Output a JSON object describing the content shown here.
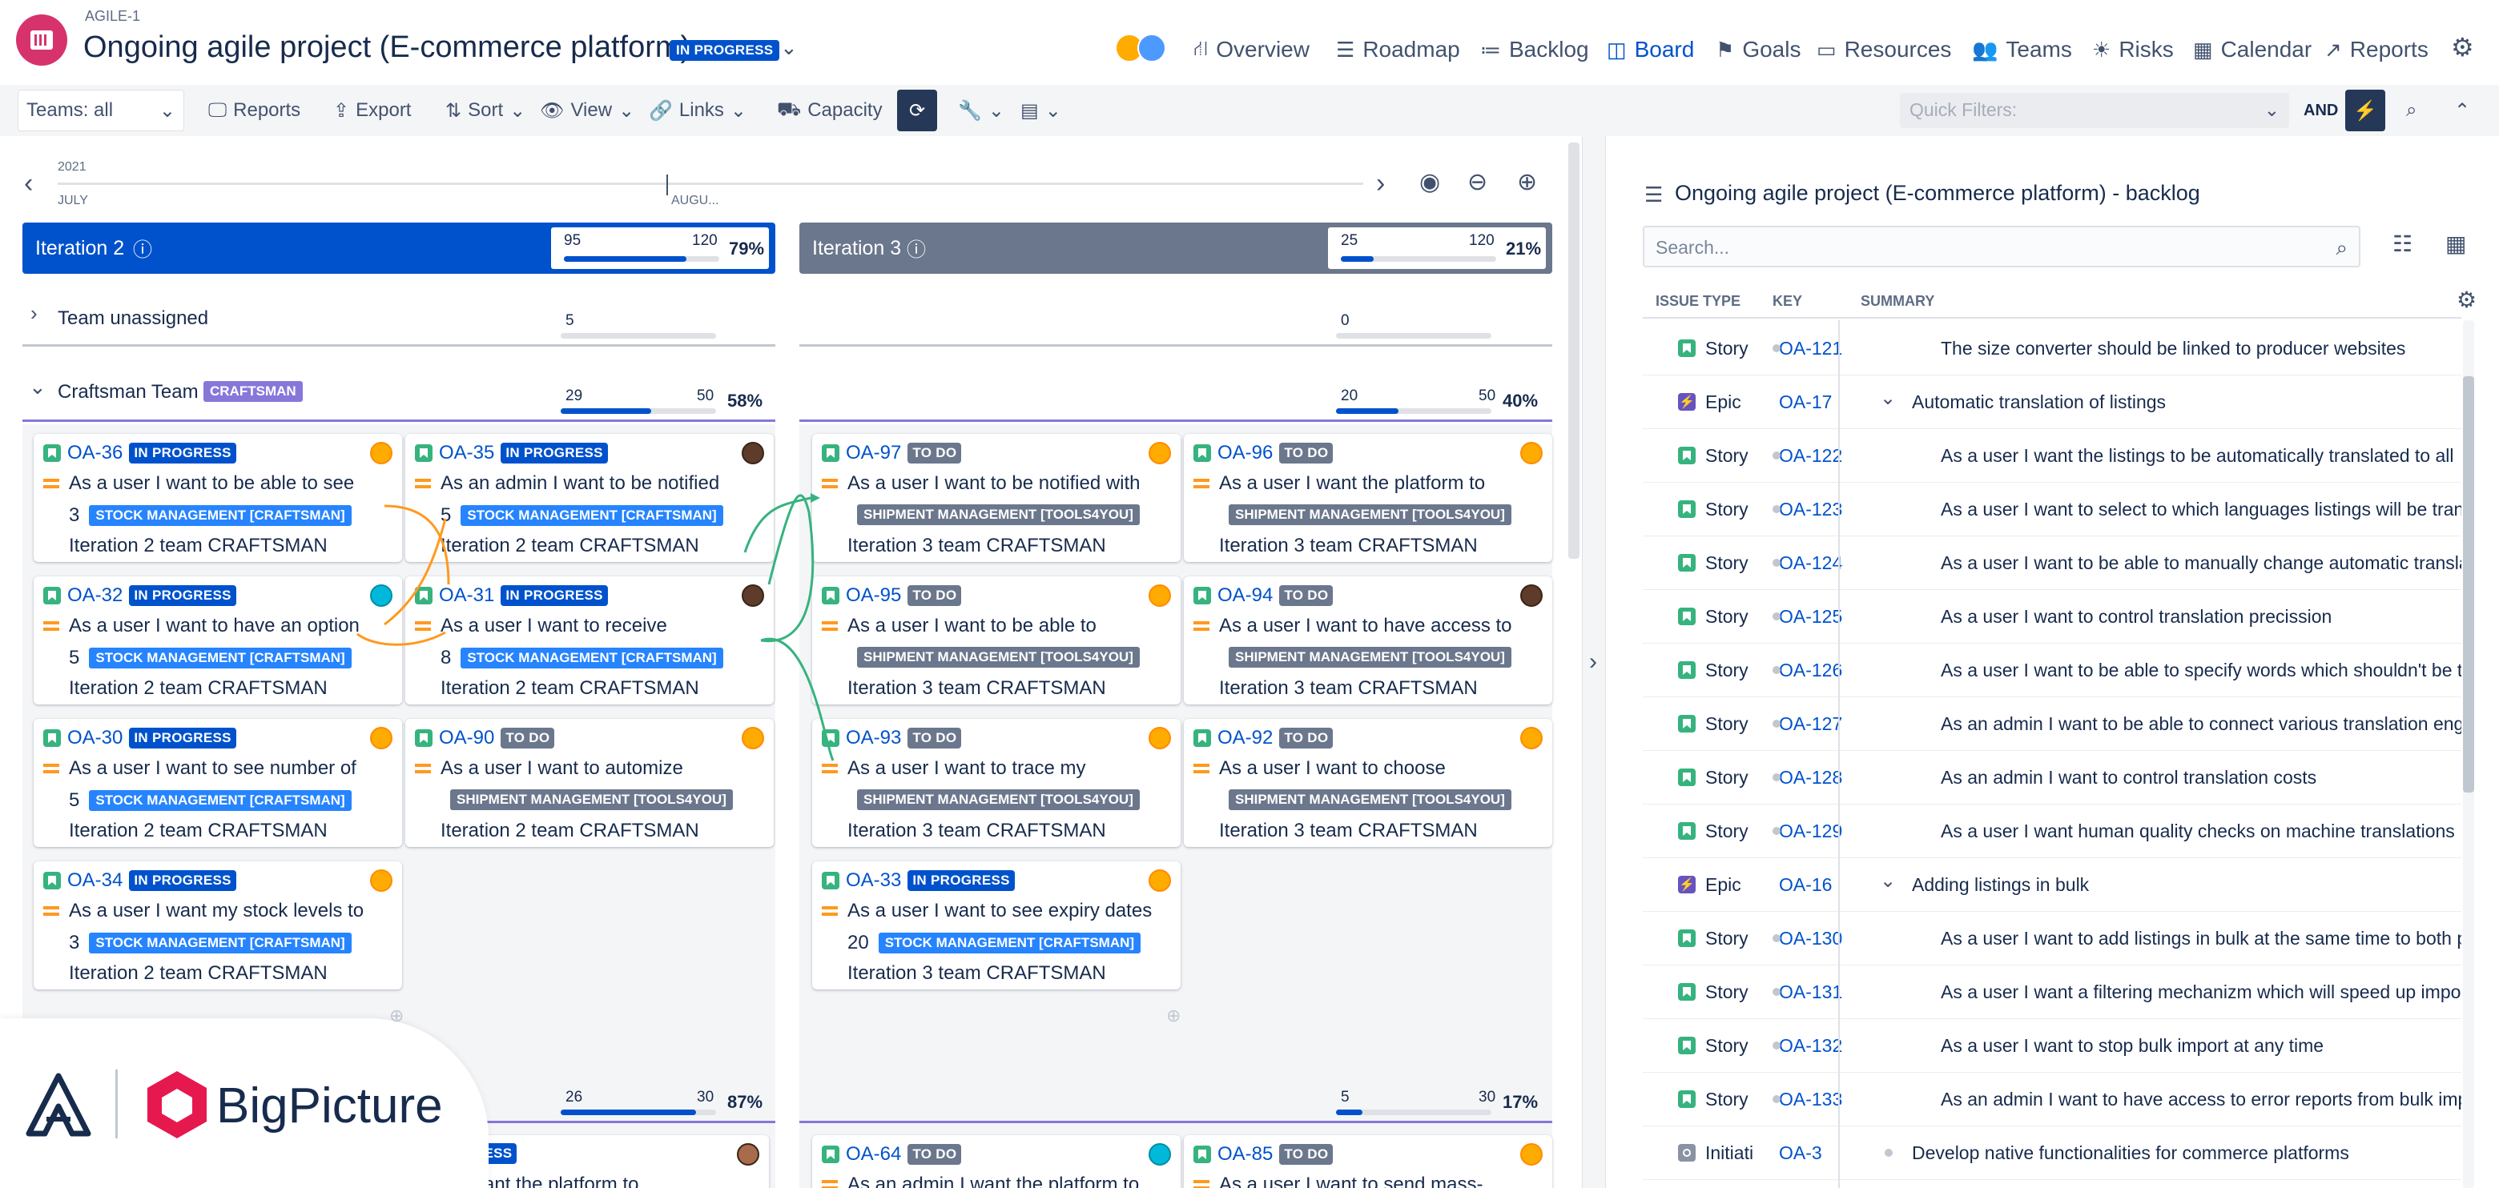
{
  "header": {
    "project_key": "AGILE-1",
    "project_title": "Ongoing agile project (E-commerce platform)",
    "status": "IN PROGRESS",
    "nav": [
      {
        "label": "Overview",
        "icon": "hierarchy-icon"
      },
      {
        "label": "Roadmap",
        "icon": "roadmap-icon"
      },
      {
        "label": "Backlog",
        "icon": "backlog-icon"
      },
      {
        "label": "Board",
        "icon": "board-icon",
        "active": true
      },
      {
        "label": "Goals",
        "icon": "goals-icon"
      },
      {
        "label": "Resources",
        "icon": "resources-icon"
      },
      {
        "label": "Teams",
        "icon": "teams-icon"
      },
      {
        "label": "Risks",
        "icon": "risks-icon"
      },
      {
        "label": "Calendar",
        "icon": "calendar-icon"
      },
      {
        "label": "Reports",
        "icon": "reports-icon"
      }
    ]
  },
  "toolbar": {
    "teams": "Teams: all",
    "reports": "Reports",
    "export": "Export",
    "sort": "Sort",
    "view": "View",
    "links": "Links",
    "capacity": "Capacity",
    "quick_filters_placeholder": "Quick Filters:",
    "and": "AND"
  },
  "timeline": {
    "year": "2021",
    "months": [
      "JULY",
      "AUGU..."
    ]
  },
  "iterations": [
    {
      "name": "Iteration 2",
      "used": "95",
      "capacity": "120",
      "percent": "79%",
      "fill": 0.79,
      "color": "#0052cc"
    },
    {
      "name": "Iteration 3",
      "used": "25",
      "capacity": "120",
      "percent": "21%",
      "fill": 0.21,
      "color": "#6b778c"
    }
  ],
  "swimlanes": {
    "unassigned": {
      "label": "Team unassigned",
      "it2_used": "5",
      "it3_used": "0"
    },
    "craftsman": {
      "label": "Craftsman Team",
      "badge": "CRAFTSMAN",
      "it2": {
        "used": "29",
        "capacity": "50",
        "percent": "58%",
        "fill": 0.58
      },
      "it3": {
        "used": "20",
        "capacity": "50",
        "percent": "40%",
        "fill": 0.4
      }
    },
    "third": {
      "it2": {
        "used": "26",
        "capacity": "30",
        "percent": "87%",
        "fill": 0.87
      },
      "it3": {
        "used": "5",
        "capacity": "30",
        "percent": "17%",
        "fill": 0.17
      }
    }
  },
  "cards": [
    {
      "key": "OA-36",
      "status": "IN PROGRESS",
      "summary": "As a user I want to be able to see",
      "points": "3",
      "epic": "STOCK MANAGEMENT [CRAFTSMAN]",
      "epic_color": "blue",
      "iteration": "Iteration 2 team CRAFTSMAN"
    },
    {
      "key": "OA-35",
      "status": "IN PROGRESS",
      "summary": "As an admin I want to be notified",
      "points": "5",
      "epic": "STOCK MANAGEMENT [CRAFTSMAN]",
      "epic_color": "blue",
      "iteration": "Iteration 2 team CRAFTSMAN"
    },
    {
      "key": "OA-97",
      "status": "TO DO",
      "summary": "As a user I want to be notified with",
      "points": "",
      "epic": "SHIPMENT MANAGEMENT [TOOLS4YOU]",
      "epic_color": "grey",
      "iteration": "Iteration 3 team CRAFTSMAN"
    },
    {
      "key": "OA-96",
      "status": "TO DO",
      "summary": "As a user I want the platform to",
      "points": "",
      "epic": "SHIPMENT MANAGEMENT [TOOLS4YOU]",
      "epic_color": "grey",
      "iteration": "Iteration 3 team CRAFTSMAN"
    },
    {
      "key": "OA-32",
      "status": "IN PROGRESS",
      "summary": "As a user I want to have an option",
      "points": "5",
      "epic": "STOCK MANAGEMENT [CRAFTSMAN]",
      "epic_color": "blue",
      "iteration": "Iteration 2 team CRAFTSMAN"
    },
    {
      "key": "OA-31",
      "status": "IN PROGRESS",
      "summary": "As a user I want to receive",
      "points": "8",
      "epic": "STOCK MANAGEMENT [CRAFTSMAN]",
      "epic_color": "blue",
      "iteration": "Iteration 2 team CRAFTSMAN"
    },
    {
      "key": "OA-95",
      "status": "TO DO",
      "summary": "As a user I want to be able to",
      "points": "",
      "epic": "SHIPMENT MANAGEMENT [TOOLS4YOU]",
      "epic_color": "grey",
      "iteration": "Iteration 3 team CRAFTSMAN"
    },
    {
      "key": "OA-94",
      "status": "TO DO",
      "summary": "As a user I want to have access to",
      "points": "",
      "epic": "SHIPMENT MANAGEMENT [TOOLS4YOU]",
      "epic_color": "grey",
      "iteration": "Iteration 3 team CRAFTSMAN"
    },
    {
      "key": "OA-30",
      "status": "IN PROGRESS",
      "summary": "As a user I want to see number of",
      "points": "5",
      "epic": "STOCK MANAGEMENT [CRAFTSMAN]",
      "epic_color": "blue",
      "iteration": "Iteration 2 team CRAFTSMAN"
    },
    {
      "key": "OA-90",
      "status": "TO DO",
      "summary": "As a user I want to automize",
      "points": "",
      "epic": "SHIPMENT MANAGEMENT [TOOLS4YOU]",
      "epic_color": "grey",
      "iteration": "Iteration 2 team CRAFTSMAN"
    },
    {
      "key": "OA-93",
      "status": "TO DO",
      "summary": "As a user I want to trace my",
      "points": "",
      "epic": "SHIPMENT MANAGEMENT [TOOLS4YOU]",
      "epic_color": "grey",
      "iteration": "Iteration 3 team CRAFTSMAN"
    },
    {
      "key": "OA-92",
      "status": "TO DO",
      "summary": "As a user I want to choose",
      "points": "",
      "epic": "SHIPMENT MANAGEMENT [TOOLS4YOU]",
      "epic_color": "grey",
      "iteration": "Iteration 3 team CRAFTSMAN"
    },
    {
      "key": "OA-34",
      "status": "IN PROGRESS",
      "summary": "As a user I want my stock levels to",
      "points": "3",
      "epic": "STOCK MANAGEMENT [CRAFTSMAN]",
      "epic_color": "blue",
      "iteration": "Iteration 2 team CRAFTSMAN"
    },
    {
      "key": "OA-33",
      "status": "IN PROGRESS",
      "summary": "As a user I want to see expiry dates",
      "points": "20",
      "epic": "STOCK MANAGEMENT [CRAFTSMAN]",
      "epic_color": "blue",
      "iteration": "Iteration 3 team CRAFTSMAN"
    }
  ],
  "bottom_cards": [
    {
      "key": "",
      "status": "IN PROGRESS",
      "summary": "user I want the platform to"
    },
    {
      "key": "OA-64",
      "status": "TO DO",
      "summary": "As an admin I want the platform to"
    },
    {
      "key": "OA-85",
      "status": "TO DO",
      "summary": "As a user I want to send mass-"
    }
  ],
  "backlog": {
    "title": "Ongoing agile project (E-commerce platform) - backlog",
    "search_placeholder": "Search...",
    "columns": [
      "ISSUE TYPE",
      "KEY",
      "SUMMARY"
    ],
    "rows": [
      {
        "type": "Story",
        "key": "OA-121",
        "summary": "The size converter should be linked to producer websites",
        "level": 2
      },
      {
        "type": "Epic",
        "key": "OA-17",
        "summary": "Automatic translation of listings",
        "level": 1
      },
      {
        "type": "Story",
        "key": "OA-122",
        "summary": "As a user I want the listings to be automatically translated to all",
        "level": 2
      },
      {
        "type": "Story",
        "key": "OA-123",
        "summary": "As a user I want to select to which languages listings will be tran",
        "level": 2
      },
      {
        "type": "Story",
        "key": "OA-124",
        "summary": "As a user I want to be able to manually change automatic transla",
        "level": 2
      },
      {
        "type": "Story",
        "key": "OA-125",
        "summary": "As a user I want to control translation precission",
        "level": 2
      },
      {
        "type": "Story",
        "key": "OA-126",
        "summary": "As a user I want to be able to specify words which shouldn't be t",
        "level": 2
      },
      {
        "type": "Story",
        "key": "OA-127",
        "summary": "As an admin I want to be able to connect various translation eng",
        "level": 2
      },
      {
        "type": "Story",
        "key": "OA-128",
        "summary": "As an admin I want to control translation costs",
        "level": 2
      },
      {
        "type": "Story",
        "key": "OA-129",
        "summary": "As a user I want human quality checks on machine translations",
        "level": 2
      },
      {
        "type": "Epic",
        "key": "OA-16",
        "summary": "Adding listings in bulk",
        "level": 1
      },
      {
        "type": "Story",
        "key": "OA-130",
        "summary": "As a user I want to add listings in bulk at the same time to both p",
        "level": 2
      },
      {
        "type": "Story",
        "key": "OA-131",
        "summary": "As a user I want a filtering mechanizm which will speed up impo",
        "level": 2
      },
      {
        "type": "Story",
        "key": "OA-132",
        "summary": "As a user I want to stop bulk import at any time",
        "level": 2
      },
      {
        "type": "Story",
        "key": "OA-133",
        "summary": "As an admin I want to have access to error reports from bulk imp",
        "level": 2
      },
      {
        "type": "Initiati",
        "key": "OA-3",
        "summary": "Develop native functionalities for commerce platforms",
        "level": 0
      }
    ]
  },
  "brand": {
    "name": "BigPicture"
  },
  "colors": {
    "primary": "#0052cc",
    "story": "#36b37e",
    "epic": "#6554c0",
    "in_progress": "#0052cc",
    "todo": "#6b778c",
    "epic_stock": "#2684ff"
  }
}
